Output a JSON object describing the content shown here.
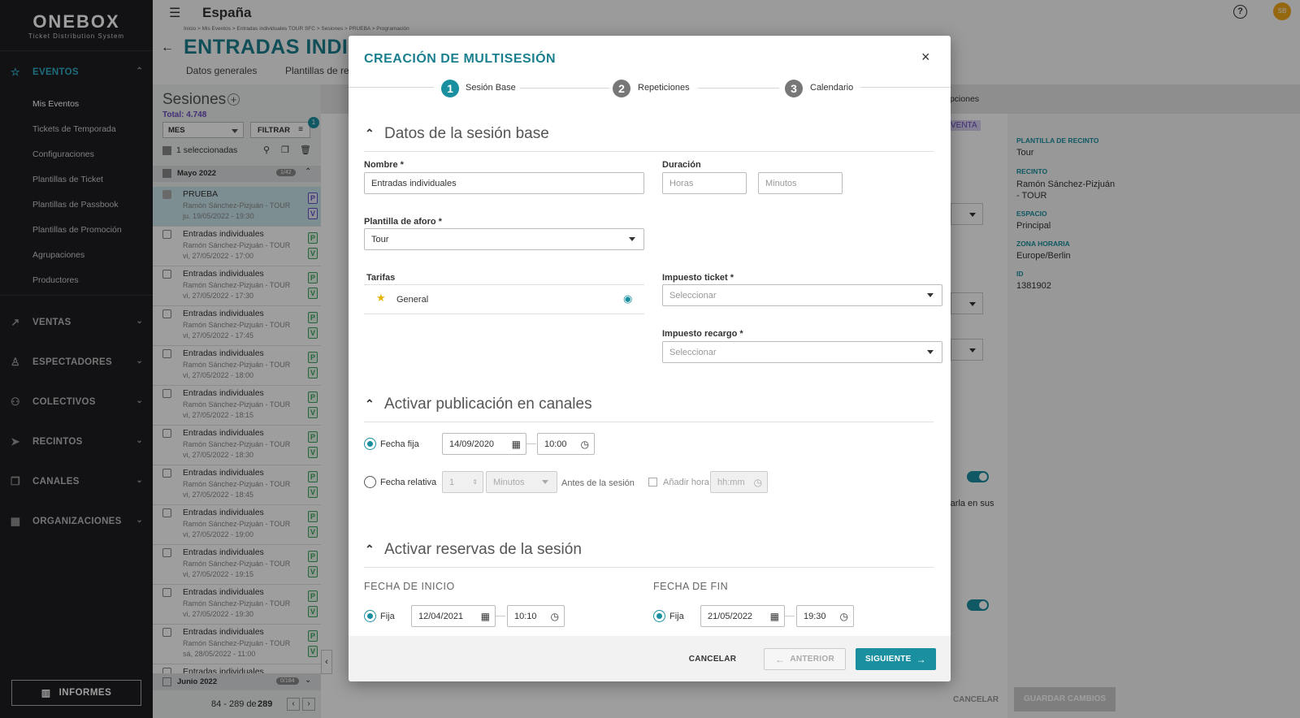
{
  "app": {
    "logo_name": "ONEBOX",
    "logo_sub": "Ticket Distribution System",
    "page_title": "España",
    "avatar": "SB"
  },
  "sidebar": {
    "sections": [
      {
        "label": "EVENTOS",
        "icon": "star-icon"
      },
      {
        "label": "VENTAS",
        "icon": "trend-icon"
      },
      {
        "label": "ESPECTADORES",
        "icon": "person-icon"
      },
      {
        "label": "COLECTIVOS",
        "icon": "group-icon"
      },
      {
        "label": "RECINTOS",
        "icon": "navigation-icon"
      },
      {
        "label": "CANALES",
        "icon": "copy-icon"
      },
      {
        "label": "ORGANIZACIONES",
        "icon": "building-icon"
      }
    ],
    "sub_items": [
      "Mis Eventos",
      "Tickets de Temporada",
      "Configuraciones",
      "Plantillas de Ticket",
      "Plantillas de Passbook",
      "Plantillas de Promoción",
      "Agrupaciones",
      "Productores"
    ],
    "informes": "INFORMES"
  },
  "event": {
    "breadcrumb": "Inicio > Mis Eventos > Entradas individuales TOUR SFC > Sesiones > PRUEBA > Programación",
    "title": "ENTRADAS INDIV",
    "tabs": [
      "Datos generales",
      "Plantillas de re"
    ],
    "right_tab": "opciones",
    "badge": "VENTA",
    "right_text": "rarla en sus"
  },
  "sessions": {
    "title": "Sesiones",
    "total": "Total: 4.748",
    "mes": "MES",
    "filtrar": "FILTRAR",
    "filter_count": "1",
    "selected": "1 seleccionadas",
    "group": "Mayo 2022",
    "group_count": "1/42",
    "group2": "Junio 2022",
    "group2_count": "0/184",
    "pagination": "84 - 289 de",
    "pagination_total": "289",
    "rows": [
      {
        "title": "PRUEBA",
        "venue": "Ramón Sánchez-Pizjuán - TOUR",
        "date": "ju. 19/05/2022 - 19:30"
      },
      {
        "title": "Entradas individuales",
        "venue": "Ramón Sánchez-Pizjuán - TOUR",
        "date": "vi, 27/05/2022 - 17:00"
      },
      {
        "title": "Entradas individuales",
        "venue": "Ramón Sánchez-Pizjuán - TOUR",
        "date": "vi, 27/05/2022 - 17:30"
      },
      {
        "title": "Entradas individuales",
        "venue": "Ramón Sánchez-Pizjuán - TOUR",
        "date": "vi, 27/05/2022 - 17:45"
      },
      {
        "title": "Entradas individuales",
        "venue": "Ramón Sánchez-Pizjuán - TOUR",
        "date": "vi, 27/05/2022 - 18:00"
      },
      {
        "title": "Entradas individuales",
        "venue": "Ramón Sánchez-Pizjuán - TOUR",
        "date": "vi, 27/05/2022 - 18:15"
      },
      {
        "title": "Entradas individuales",
        "venue": "Ramón Sánchez-Pizjuán - TOUR",
        "date": "vi, 27/05/2022 - 18:30"
      },
      {
        "title": "Entradas individuales",
        "venue": "Ramón Sánchez-Pizjuán - TOUR",
        "date": "vi, 27/05/2022 - 18:45"
      },
      {
        "title": "Entradas individuales",
        "venue": "Ramón Sánchez-Pizjuán - TOUR",
        "date": "vi, 27/05/2022 - 19:00"
      },
      {
        "title": "Entradas individuales",
        "venue": "Ramón Sánchez-Pizjuán - TOUR",
        "date": "vi, 27/05/2022 - 19:15"
      },
      {
        "title": "Entradas individuales",
        "venue": "Ramón Sánchez-Pizjuán - TOUR",
        "date": "vi, 27/05/2022 - 19:30"
      },
      {
        "title": "Entradas individuales",
        "venue": "Ramón Sánchez-Pizjuán - TOUR",
        "date": "sá, 28/05/2022 - 11:00"
      },
      {
        "title": "Entradas individuales",
        "venue": "",
        "date": ""
      }
    ]
  },
  "info_panel": {
    "items": [
      {
        "label": "PLANTILLA DE RECINTO",
        "value": "Tour"
      },
      {
        "label": "RECINTO",
        "value": "Ramón Sánchez-Pizjuán\n- TOUR"
      },
      {
        "label": "ESPACIO",
        "value": "Principal"
      },
      {
        "label": "ZONA HORARIA",
        "value": "Europe/Berlin"
      },
      {
        "label": "ID",
        "value": "1381902"
      }
    ],
    "cancel": "CANCELAR",
    "save": "GUARDAR CAMBIOS"
  },
  "modal": {
    "title": "CREACIÓN DE MULTISESIÓN",
    "steps": [
      {
        "num": "1",
        "label": "Sesión Base"
      },
      {
        "num": "2",
        "label": "Repeticiones"
      },
      {
        "num": "3",
        "label": "Calendario"
      }
    ],
    "section1": "Datos de la sesión base",
    "nombre_label": "Nombre *",
    "nombre_value": "Entradas individuales",
    "duracion_label": "Duración",
    "horas_ph": "Horas",
    "minutos_ph": "Minutos",
    "plantilla_label": "Plantilla de aforo *",
    "plantilla_value": "Tour",
    "tarifas_label": "Tarifas",
    "tarifa_general": "General",
    "impuesto_ticket_label": "Impuesto ticket *",
    "impuesto_recargo_label": "Impuesto recargo *",
    "seleccionar": "Seleccionar",
    "section2": "Activar publicación en canales",
    "fecha_fija": "Fecha fija",
    "fecha_fija_date": "14/09/2020",
    "fecha_fija_time": "10:00",
    "fecha_relativa": "Fecha relativa",
    "rel_value": "1",
    "rel_unit": "Minutos",
    "antes": "Antes de la sesión",
    "anadir_hora": "Añadir hora",
    "hhmm": "hh:mm",
    "section3": "Activar reservas de la sesión",
    "fecha_inicio": "FECHA DE INICIO",
    "fecha_fin": "FECHA DE FIN",
    "fija": "Fija",
    "inicio_date": "12/04/2021",
    "inicio_time": "10:10",
    "fin_date": "21/05/2022",
    "fin_time": "19:30",
    "cancelar": "CANCELAR",
    "anterior": "ANTERIOR",
    "siguiente": "SIGUIENTE"
  },
  "colors": {
    "accent": "#1a8fa0",
    "sidebar_bg": "#1d1e22",
    "title_teal": "#1a7f8e"
  }
}
